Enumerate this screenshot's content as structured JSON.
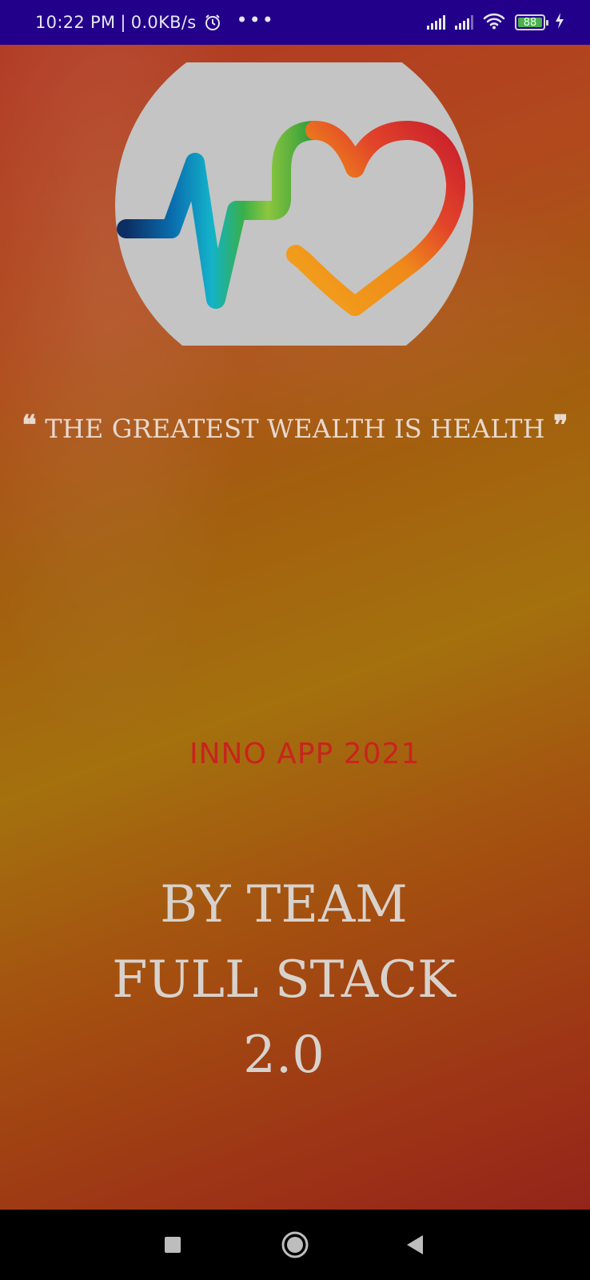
{
  "status_bar": {
    "time": "10:22 PM",
    "speed": "0.0KB/s",
    "separator": "|",
    "more": "•••",
    "battery_level": "88"
  },
  "splash": {
    "quote_text": "THE GREATEST WEALTH IS HEALTH",
    "quote_open": "❝",
    "quote_close": "❞",
    "app_label": "INNO APP 2021",
    "team_line1": "BY TEAM",
    "team_line2": "FULL STACK",
    "team_line3": "2.0"
  },
  "icons": {
    "alarm": "alarm-icon",
    "signal": "signal-icon",
    "wifi": "wifi-icon",
    "battery": "battery-icon",
    "charging": "charging-icon",
    "recents": "recents-square-icon",
    "home": "home-circle-icon",
    "back": "back-triangle-icon"
  },
  "colors": {
    "status_bar": "#23008a",
    "app_label": "#c8241e",
    "logo_background": "#c4c4c4"
  }
}
